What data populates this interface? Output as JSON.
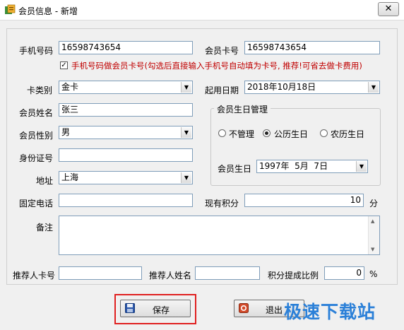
{
  "window": {
    "title": "会员信息 - 新增",
    "close_glyph": "✕"
  },
  "form": {
    "phone_label": "手机号码",
    "phone_value": "16598743654",
    "card_label": "会员卡号",
    "card_value": "16598743654",
    "checkbox_checked": true,
    "checkbox_text": "手机号码做会员卡号(勾选后直接输入手机号自动填为卡号, 推荐!可省去做卡费用)",
    "card_type_label": "卡类别",
    "card_type_value": "金卡",
    "start_date_label": "起用日期",
    "start_date_value": "2018年10月18日",
    "name_label": "会员姓名",
    "name_value": "张三",
    "gender_label": "会员性别",
    "gender_value": "男",
    "id_label": "身份证号",
    "id_value": "",
    "address_label": "地址",
    "address_value": "上海",
    "phone_fixed_label": "固定电话",
    "phone_fixed_value": "",
    "points_label": "现有积分",
    "points_value": "10",
    "points_unit": "分",
    "note_label": "备注",
    "note_value": "",
    "referrer_card_label": "推荐人卡号",
    "referrer_card_value": "",
    "referrer_name_label": "推荐人姓名",
    "referrer_name_value": "",
    "ratio_label": "积分提成比例",
    "ratio_value": "0",
    "ratio_unit": "%"
  },
  "birthday_group": {
    "title": "会员生日管理",
    "options": [
      "不管理",
      "公历生日",
      "农历生日"
    ],
    "selected_index": 1,
    "birthday_label": "会员生日",
    "birthday_value": "1997年  5月  7日"
  },
  "buttons": {
    "save": "保存",
    "exit": "退出"
  },
  "watermark": "极速下载站",
  "colors": {
    "highlight_frame": "#e02020",
    "note_text": "#c00000",
    "watermark": "#2b80d8"
  }
}
